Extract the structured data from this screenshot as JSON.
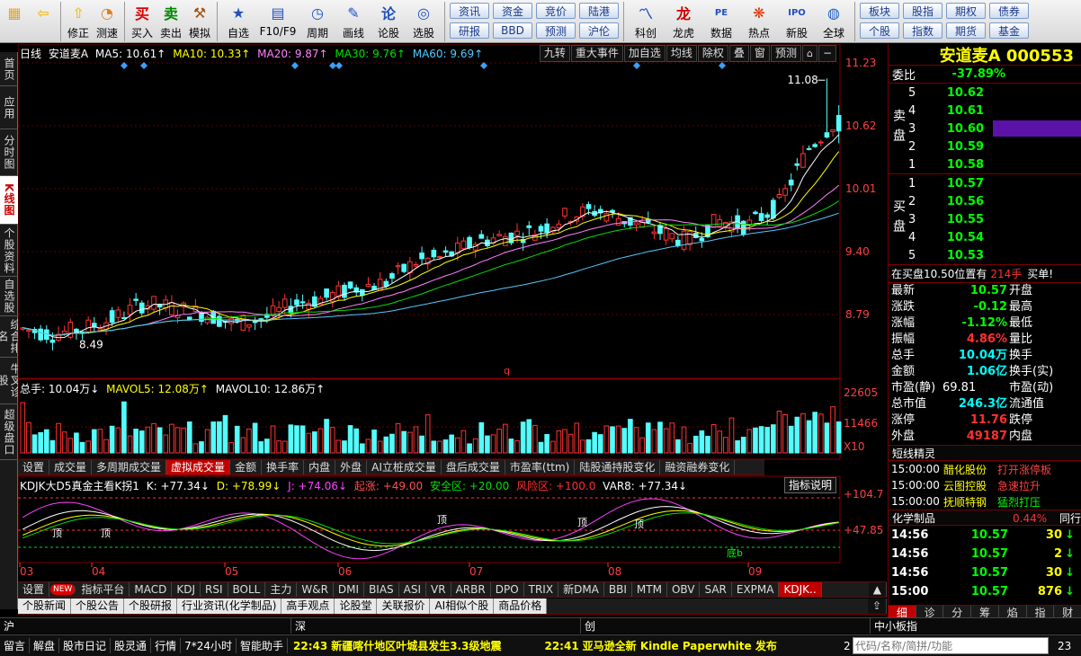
{
  "toolbar": {
    "buttons": [
      {
        "label": "",
        "icon": "windows-logo-icon"
      },
      {
        "label": "",
        "icon": "back-arrow-icon"
      },
      {
        "label": "修正",
        "icon": "up-arrow-icon"
      },
      {
        "label": "测速",
        "icon": "gauge-icon"
      },
      {
        "label": "买入",
        "icon": "buy-icon"
      },
      {
        "label": "卖出",
        "icon": "sell-icon"
      },
      {
        "label": "模拟",
        "icon": "hammer-icon"
      },
      {
        "label": "自选",
        "icon": "star-icon"
      },
      {
        "label": "F10/F9",
        "icon": "f10-icon"
      },
      {
        "label": "周期",
        "icon": "clock-icon"
      },
      {
        "label": "画线",
        "icon": "pencil-icon"
      },
      {
        "label": "论股",
        "icon": "discuss-icon"
      },
      {
        "label": "选股",
        "icon": "select-stock-icon"
      }
    ],
    "grid_left": [
      [
        "资讯",
        "研报"
      ],
      [
        "资金",
        "BBD"
      ],
      [
        "竞价",
        "预测"
      ],
      [
        "陆港",
        "沪伦"
      ]
    ],
    "buttons2": [
      {
        "label": "科创",
        "icon": "chart-icon"
      },
      {
        "label": "龙虎",
        "icon": "dragon-icon"
      },
      {
        "label": "数据",
        "icon": "pe-icon"
      },
      {
        "label": "热点",
        "icon": "hot-icon"
      },
      {
        "label": "新股",
        "icon": "ipo-icon"
      },
      {
        "label": "全球",
        "icon": "globe-icon"
      }
    ],
    "grid_right": [
      [
        "板块",
        "个股"
      ],
      [
        "股指",
        "指数"
      ],
      [
        "期权",
        "期货"
      ],
      [
        "债券",
        "基金"
      ]
    ]
  },
  "left_tabs": [
    "首页",
    "应用",
    "分时图",
    "K线图",
    "个股资料",
    "自选股",
    "综合排名",
    "牛叉诊股",
    "超级盘口"
  ],
  "left_active": "K线图",
  "chart_header": {
    "period": "日线",
    "stock": "安道麦A",
    "ma5": "MA5: 10.61↑",
    "ma10": "MA10: 10.33↑",
    "ma20": "MA20: 9.87↑",
    "ma30": "MA30: 9.76↑",
    "ma60": "MA60: 9.69↑"
  },
  "top_buttons": [
    "九转",
    "重大事件",
    "加自选",
    "均线",
    "除权",
    "叠",
    "窗",
    "预测"
  ],
  "price_axis": [
    "11.23",
    "10.62",
    "10.01",
    "9.40",
    "8.79"
  ],
  "annotations": {
    "high": "11.08",
    "low": "8.49",
    "marker": "q"
  },
  "volume_header": {
    "total": "总手: 10.04万↓",
    "mavol5": "MAVOL5: 12.08万↑",
    "mavol10": "MAVOL10: 12.86万↑"
  },
  "volume_axis": [
    "22605",
    "11466",
    "X10"
  ],
  "vol_tabs": [
    "设置",
    "成交量",
    "多周期成交量",
    "虚拟成交量",
    "金额",
    "换手率",
    "内盘",
    "外盘",
    "AI立桩成交量",
    "盘后成交量",
    "市盈率(ttm)",
    "陆股通持股变化",
    "融资融券变化"
  ],
  "vol_tab_active": "虚拟成交量",
  "kdj_header": {
    "name": "KDJK大D5真金主看K拐1",
    "k": "K: +77.34↓",
    "d": "D: +78.99↓",
    "j": "J: +74.06↓",
    "qizhang": "起涨: +49.00",
    "anquan": "安全区: +20.00",
    "fengxian": "风险区: +100.0",
    "var8": "VAR8: +77.34↓"
  },
  "kdj_button": "指标说明",
  "kdj_axis": [
    "+104.7",
    "+47.85"
  ],
  "kdj_labels": [
    "顶",
    "顶",
    "顶",
    "顶",
    "顶",
    "底b"
  ],
  "months": [
    "03",
    "04",
    "05",
    "06",
    "07",
    "08",
    "09"
  ],
  "indicator_tabs": [
    "设置",
    "NEW",
    "指标平台",
    "MACD",
    "KDJ",
    "RSI",
    "BOLL",
    "主力",
    "W&R",
    "DMI",
    "BIAS",
    "ASI",
    "VR",
    "ARBR",
    "DPO",
    "TRIX",
    "新DMA",
    "BBI",
    "MTM",
    "OBV",
    "SAR",
    "EXPMA",
    "KDJK.."
  ],
  "indicator_active": "KDJK..",
  "news_tabs": [
    "个股新闻",
    "个股公告",
    "个股研报",
    "行业资讯(化学制品)",
    "高手观点",
    "论股堂",
    "关联报价",
    "AI相似个股",
    "商品价格"
  ],
  "right": {
    "title": "安道麦A 000553",
    "weibi_label": "委比",
    "weibi": "-37.89%",
    "sell_label": "卖盘",
    "buy_label": "买盘",
    "sells": [
      {
        "lvl": "5",
        "price": "10.62"
      },
      {
        "lvl": "4",
        "price": "10.61"
      },
      {
        "lvl": "3",
        "price": "10.60"
      },
      {
        "lvl": "2",
        "price": "10.59"
      },
      {
        "lvl": "1",
        "price": "10.58"
      }
    ],
    "buys": [
      {
        "lvl": "1",
        "price": "10.57"
      },
      {
        "lvl": "2",
        "price": "10.56"
      },
      {
        "lvl": "3",
        "price": "10.55"
      },
      {
        "lvl": "4",
        "price": "10.54"
      },
      {
        "lvl": "5",
        "price": "10.53"
      }
    ],
    "pos_text": "在买盘10.50位置有",
    "pos_vol": "214手",
    "pos_action": "买单!",
    "quote": [
      {
        "k": "最新",
        "v": "10.57",
        "k2": "开盘"
      },
      {
        "k": "涨跌",
        "v": "-0.12",
        "k2": "最高"
      },
      {
        "k": "涨幅",
        "v": "-1.12%",
        "k2": "最低"
      },
      {
        "k": "振幅",
        "v": "4.86%",
        "k2": "量比"
      },
      {
        "k": "总手",
        "v": "10.04万",
        "k2": "换手"
      },
      {
        "k": "金额",
        "v": "1.06亿",
        "k2": "换手(实)"
      },
      {
        "k": "市盈(静)",
        "v": "69.81",
        "k2": "市盈(动)"
      },
      {
        "k": "总市值",
        "v": "246.3亿",
        "k2": "流通值"
      },
      {
        "k": "涨停",
        "v": "11.76",
        "k2": "跌停"
      },
      {
        "k": "外盘",
        "v": "49187",
        "k2": "内盘"
      }
    ],
    "short_title": "短线精灵",
    "short_items": [
      {
        "t": "15:00:00",
        "name": "醋化股份",
        "ev": "打开涨停板"
      },
      {
        "t": "15:00:00",
        "name": "云图控股",
        "ev": "急速拉升"
      },
      {
        "t": "15:00:00",
        "name": "抚顺特钢",
        "ev": "猛烈打压"
      }
    ],
    "sector": "化学制品",
    "sector_pct": "0.44%",
    "sector_more": "同行",
    "ticks": [
      {
        "t": "14:56",
        "p": "10.57",
        "v": "30",
        "d": "↓"
      },
      {
        "t": "14:56",
        "p": "10.57",
        "v": "2",
        "d": "↓"
      },
      {
        "t": "14:56",
        "p": "10.57",
        "v": "30",
        "d": "↓"
      },
      {
        "t": "15:00",
        "p": "10.57",
        "v": "876",
        "d": "↓"
      }
    ],
    "bottom_tabs": [
      "细",
      "诊",
      "分",
      "筹",
      "焰",
      "指",
      "财"
    ]
  },
  "index_bar": {
    "sh": "沪",
    "sz": "深",
    "cy": "创",
    "zxb": "中小板指"
  },
  "status": {
    "items": [
      "留言",
      "解盘",
      "股市日记",
      "股灵通",
      "行情",
      "7*24小时",
      "智能助手"
    ],
    "news1_time": "22:43",
    "news1": "新疆喀什地区叶城县发生3.3级地震",
    "news2_time": "22:41",
    "news2": "亚马逊全新 Kindle Paperwhite 发布",
    "num": "2",
    "search_placeholder": "代码/名称/简拼/功能",
    "clock": "23"
  },
  "colors": {
    "up": "#ff3232",
    "down": "#54fcfc",
    "ma5": "#ffffff",
    "ma10": "#ffff00",
    "ma20": "#ff80ff",
    "ma30": "#00e000",
    "ma60": "#54c8ff"
  }
}
